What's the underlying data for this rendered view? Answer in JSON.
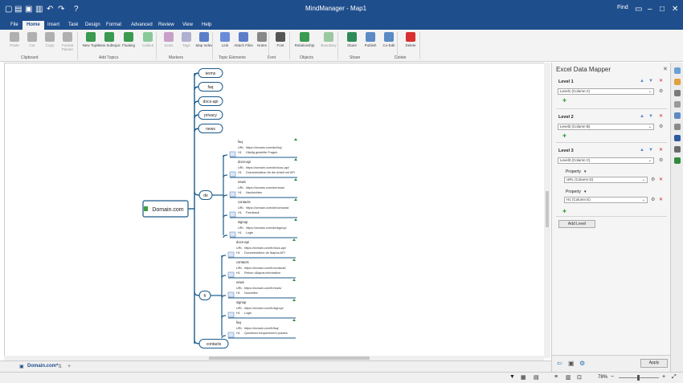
{
  "app": {
    "title": "MindManager - Map1",
    "find": "Find"
  },
  "tabs": [
    "File",
    "Home",
    "Insert",
    "Task",
    "Design",
    "Format",
    "Advanced",
    "Review",
    "View",
    "Help"
  ],
  "ribbon": {
    "buttons": [
      {
        "label": "Paste",
        "dim": true
      },
      {
        "label": "Cut",
        "dim": true
      },
      {
        "label": "Copy",
        "dim": true
      },
      {
        "label": "Format Painter",
        "dim": true
      },
      {
        "label": "New Topic"
      },
      {
        "label": "New Subtopic"
      },
      {
        "label": "Floating"
      },
      {
        "label": "Callout",
        "dim": true
      },
      {
        "label": "Icons",
        "dim": true
      },
      {
        "label": "Tags",
        "dim": true
      },
      {
        "label": "Map Index"
      },
      {
        "label": "Link"
      },
      {
        "label": "Attach Files"
      },
      {
        "label": "Notes"
      },
      {
        "label": "Font"
      },
      {
        "label": "Relationship"
      },
      {
        "label": "Boundary",
        "dim": true
      },
      {
        "label": "Share"
      },
      {
        "label": "Publish"
      },
      {
        "label": "Co-Edit"
      },
      {
        "label": "Delete"
      }
    ],
    "groups": [
      "Clipboard",
      "Add Topics",
      "Markers",
      "Topic Elements",
      "Font",
      "Objects",
      "Share",
      "Delete"
    ]
  },
  "map": {
    "central": "Domain.com",
    "left_topics": [
      "terms",
      "faq",
      "docs-api",
      "privacy",
      "news"
    ],
    "de": "de",
    "fr": "fr",
    "contacts": "contacts",
    "de_children": [
      {
        "name": "faq",
        "url_label": "URL",
        "url": "https://domain.com/de/faq/",
        "h1_label": "H1",
        "h1": "Häufig gestellte Fragen"
      },
      {
        "name": "docs-api",
        "url_label": "URL",
        "url": "https://domain.com/de/docs-api/",
        "h1_label": "H1",
        "h1": "Dokumentation für die Arbeit mit API"
      },
      {
        "name": "news",
        "url_label": "URL",
        "url": "https://domain.com/de/news/",
        "h1_label": "H1",
        "h1": "Nachrichten"
      },
      {
        "name": "contacts",
        "url_label": "URL",
        "url": "https://domain.com/de/contacts/",
        "h1_label": "H1",
        "h1": "Feedback"
      },
      {
        "name": "signup",
        "url_label": "URL",
        "url": "https://domain.com/de/signup/",
        "h1_label": "H1",
        "h1": "Login"
      }
    ],
    "fr_children": [
      {
        "name": "docs-api",
        "url_label": "URL",
        "url": "https://domain.com/fr/docs-api/",
        "h1_label": "H1",
        "h1": "Documentation de l&apos;API"
      },
      {
        "name": "contacts",
        "url_label": "URL",
        "url": "https://domain.com/fr/contacts/",
        "h1_label": "H1",
        "h1": "Retour d&apos;information"
      },
      {
        "name": "news",
        "url_label": "URL",
        "url": "https://domain.com/fr/news/",
        "h1_label": "H1",
        "h1": "Nouvelles"
      },
      {
        "name": "signup",
        "url_label": "URL",
        "url": "https://domain.com/fr/signup/",
        "h1_label": "H1",
        "h1": "Login"
      },
      {
        "name": "faq",
        "url_label": "URL",
        "url": "https://domain.com/fr/faq/",
        "h1_label": "H1",
        "h1": "Questions fréquemment posées"
      }
    ]
  },
  "panel": {
    "title": "Excel Data Mapper",
    "levels": [
      {
        "name": "Level 1",
        "column": "Level1 (Column A)"
      },
      {
        "name": "Level 2",
        "column": "Level2 (Column B)"
      },
      {
        "name": "Level 3",
        "column": "Level3 (Column C)"
      }
    ],
    "property_label": "Property",
    "properties": [
      "URL (Column D)",
      "H1 (Column E)"
    ],
    "add_level": "Add Level",
    "apply": "Apply"
  },
  "doc_tab": "Domain.com*",
  "status": {
    "zoom": "78%"
  },
  "colors": {
    "accent": "#1f4e8c",
    "branch": "#1a5a8a",
    "topic_border": "#1a5a8a"
  }
}
